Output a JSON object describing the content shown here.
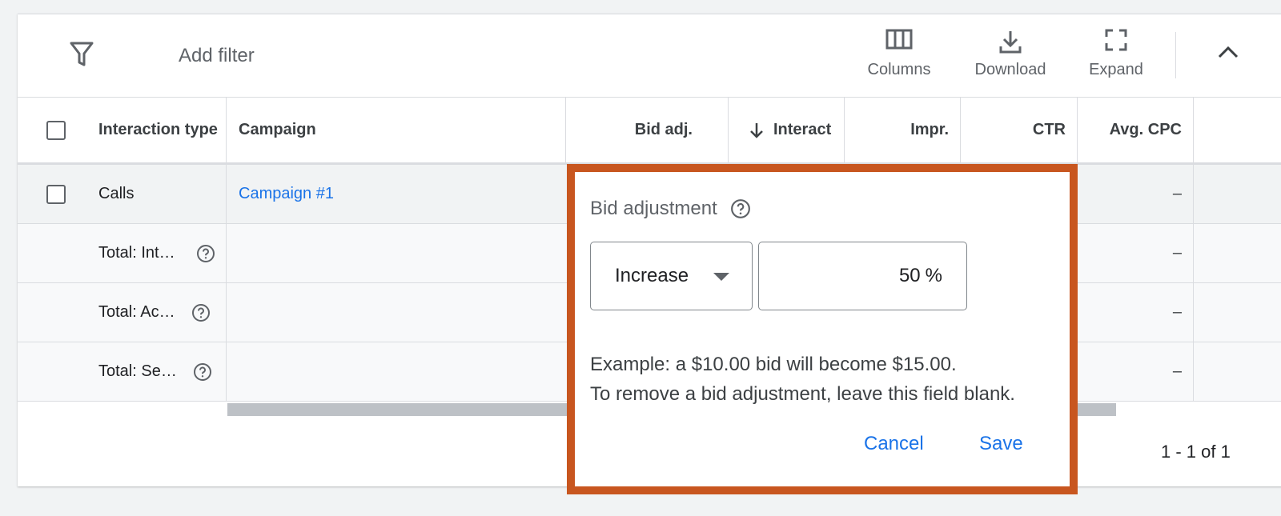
{
  "toolbar": {
    "add_filter": "Add filter",
    "columns": "Columns",
    "download": "Download",
    "expand": "Expand"
  },
  "table": {
    "headers": {
      "interaction_type": "Interaction type",
      "campaign": "Campaign",
      "bid_adj": "Bid adj.",
      "interactions": "Interact",
      "impr": "Impr.",
      "ctr": "CTR",
      "avg_cpc": "Avg. CPC"
    },
    "rows": [
      {
        "interaction_type": "Calls",
        "campaign": "Campaign #1",
        "avg_cpc": "–"
      },
      {
        "interaction_type": "Total: Int…",
        "avg_cpc": "–"
      },
      {
        "interaction_type": "Total: Ac…",
        "avg_cpc": "–"
      },
      {
        "interaction_type": "Total: Se…",
        "avg_cpc": "–"
      }
    ]
  },
  "pagination": "1 - 1 of 1",
  "popup": {
    "title": "Bid adjustment",
    "direction": "Increase",
    "value": "50",
    "unit": "%",
    "example_line1": "Example: a $10.00 bid will become $15.00.",
    "example_line2": "To remove a bid adjustment, leave this field blank.",
    "cancel": "Cancel",
    "save": "Save"
  },
  "colors": {
    "highlight_border": "#c8561f",
    "link": "#1a73e8"
  }
}
